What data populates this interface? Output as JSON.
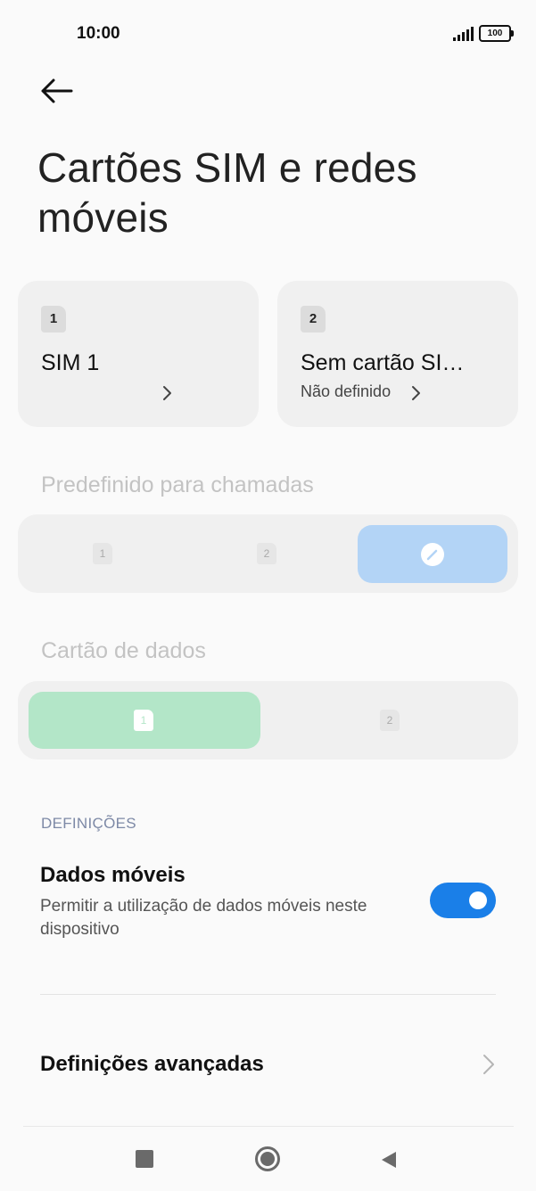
{
  "status": {
    "time": "10:00",
    "battery": "100"
  },
  "page": {
    "title": "Cartões SIM e redes móveis"
  },
  "sims": [
    {
      "badge": "1",
      "name": "SIM 1",
      "sub": ""
    },
    {
      "badge": "2",
      "name": "Sem cartão SI…",
      "sub": "Não definido"
    }
  ],
  "calls": {
    "label": "Predefinido para chamadas",
    "options": [
      "1",
      "2"
    ],
    "selected": "ask"
  },
  "data_card": {
    "label": "Cartão de dados",
    "options": [
      "1",
      "2"
    ],
    "selected": "1"
  },
  "settings": {
    "header": "DEFINIÇÕES",
    "mobile_data": {
      "title": "Dados móveis",
      "desc": "Permitir a utilização de dados móveis neste dispositivo",
      "enabled": true
    },
    "advanced": {
      "label": "Definições avançadas"
    }
  },
  "colors": {
    "toggle_on": "#1a7fe8",
    "calls_selected": "#b3d4f6",
    "data_selected": "#b3e6c8"
  },
  "icons": {
    "back": "back-arrow-icon",
    "edit": "pencil-icon",
    "chevron": "chevron-right-icon"
  }
}
